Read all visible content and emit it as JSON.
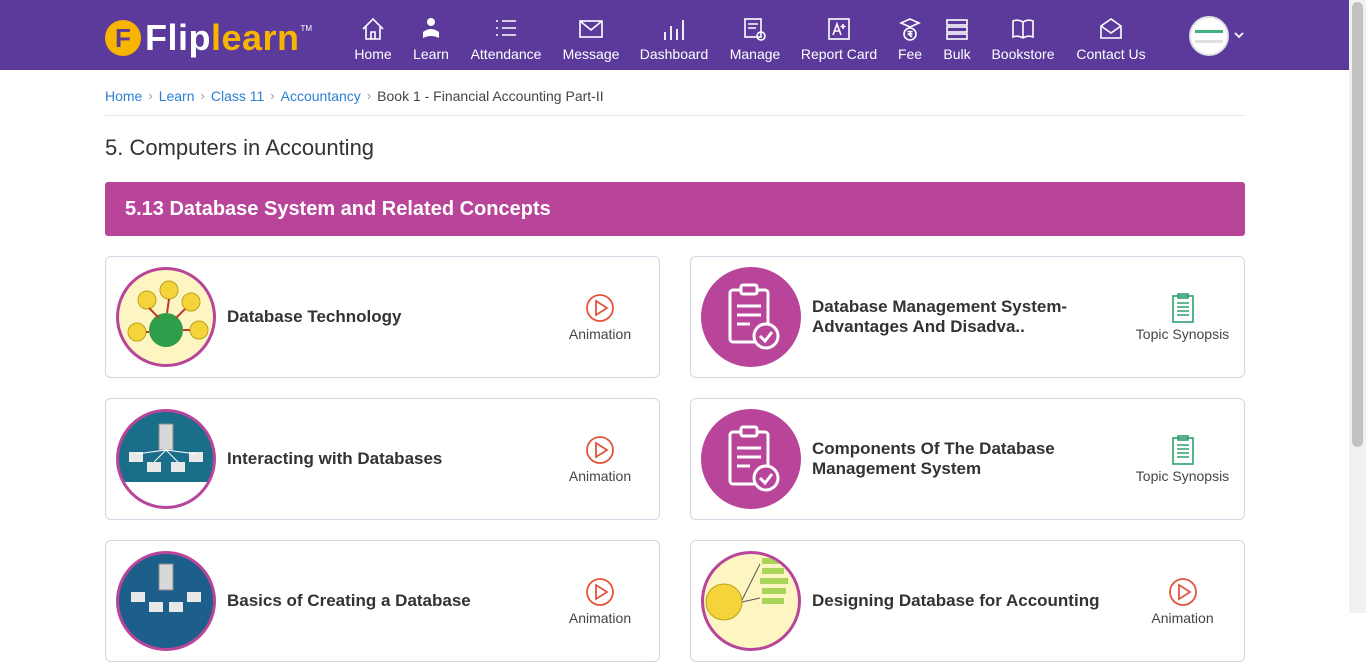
{
  "brand": {
    "mark": "F",
    "name_part1": "Flip",
    "name_part2": "learn",
    "tm": "TM"
  },
  "nav": {
    "home": "Home",
    "learn": "Learn",
    "attendance": "Attendance",
    "message": "Message",
    "dashboard": "Dashboard",
    "manage": "Manage",
    "report_card": "Report Card",
    "fee": "Fee",
    "bulk": "Bulk",
    "bookstore": "Bookstore",
    "contact_us": "Contact Us"
  },
  "breadcrumb": {
    "items": [
      "Home",
      "Learn",
      "Class 11",
      "Accountancy"
    ],
    "current": "Book 1 - Financial Accounting Part-II"
  },
  "page_title": "5. Computers in Accounting",
  "section_title": "5.13 Database System and Related Concepts",
  "cards": [
    {
      "title": "Database Technology",
      "action": "Animation",
      "thumb_icon": "database-technology-diagram"
    },
    {
      "title": "Database Management System-Advantages And Disadva..",
      "action": "Topic Synopsis",
      "thumb_icon": "clipboard-check-icon"
    },
    {
      "title": "Interacting with Databases",
      "action": "Animation",
      "thumb_icon": "server-network-diagram"
    },
    {
      "title": "Components Of The Database Management System",
      "action": "Topic Synopsis",
      "thumb_icon": "clipboard-check-icon"
    },
    {
      "title": "Basics of Creating a Database",
      "action": "Animation",
      "thumb_icon": "server-network-diagram"
    },
    {
      "title": "Designing Database for Accounting",
      "action": "Animation",
      "thumb_icon": "flowchart-diagram"
    }
  ],
  "colors": {
    "header": "#5b3a9b",
    "accent": "#b9459a",
    "logo_yellow": "#f7b500",
    "play_icon": "#e0563f",
    "synopsis_icon": "#2f9e6e",
    "link": "#2a7fd4"
  }
}
